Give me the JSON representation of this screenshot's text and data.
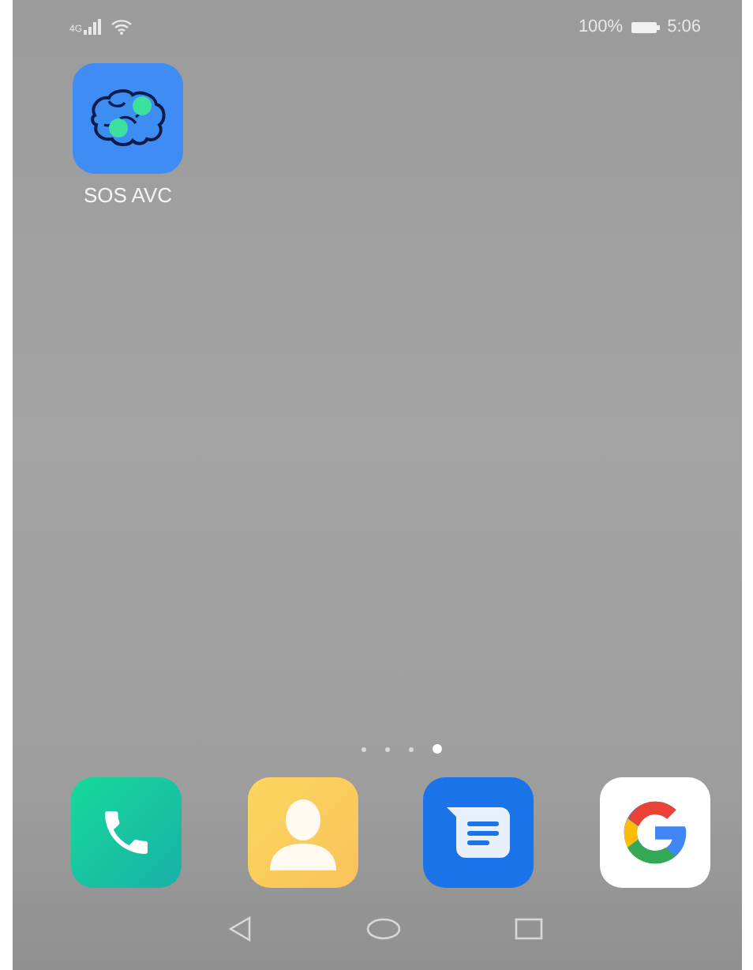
{
  "status_bar": {
    "network": "4G",
    "battery": "100%",
    "time": "5:06"
  },
  "home_apps": [
    {
      "label": "SOS AVC",
      "kind": "brain"
    }
  ],
  "page_dots": [
    {
      "selected": false
    },
    {
      "selected": false
    },
    {
      "selected": false
    },
    {
      "selected": true
    }
  ],
  "dock": [
    {
      "kind": "phone"
    },
    {
      "kind": "contacts"
    },
    {
      "kind": "messages"
    },
    {
      "kind": "google"
    }
  ]
}
